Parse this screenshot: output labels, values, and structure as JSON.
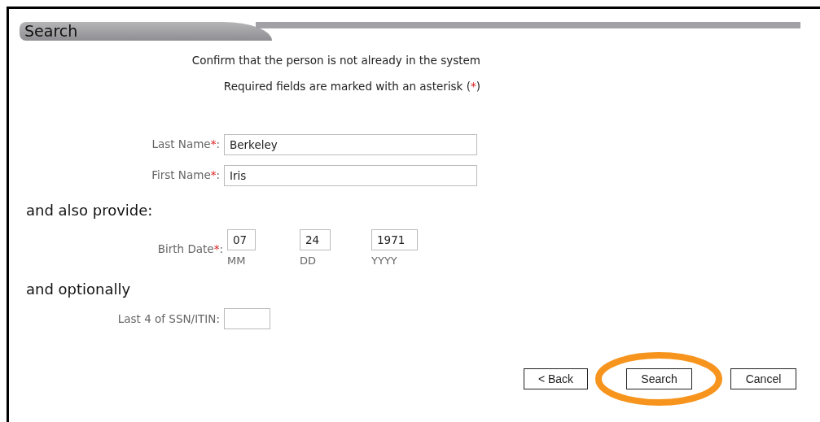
{
  "section_title": "Search",
  "intro": "Confirm that the person is not already in the system",
  "required_note": {
    "before": "Required fields are marked with an asterisk (",
    "mark": "*",
    "after": ")"
  },
  "name_fields": [
    {
      "label": "Last Name",
      "required_mark": "*",
      "suffix": ":",
      "value": "Berkeley"
    },
    {
      "label": "First Name",
      "required_mark": "*",
      "suffix": ":",
      "value": "Iris"
    }
  ],
  "also_provide": "and also provide:",
  "birth_date": {
    "label": "Birth Date",
    "required_mark": "*",
    "suffix": ":",
    "parts": [
      {
        "value": "07",
        "caption": "MM"
      },
      {
        "value": "24",
        "caption": "DD"
      },
      {
        "value": "1971",
        "caption": "YYYY"
      }
    ]
  },
  "optionally": "and optionally",
  "ssn_field": {
    "label": "Last 4 of SSN/ITIN:"
  },
  "buttons": [
    {
      "label": "< Back",
      "highlighted": false
    },
    {
      "label": "Search",
      "highlighted": true
    },
    {
      "label": "Cancel",
      "highlighted": false
    }
  ]
}
